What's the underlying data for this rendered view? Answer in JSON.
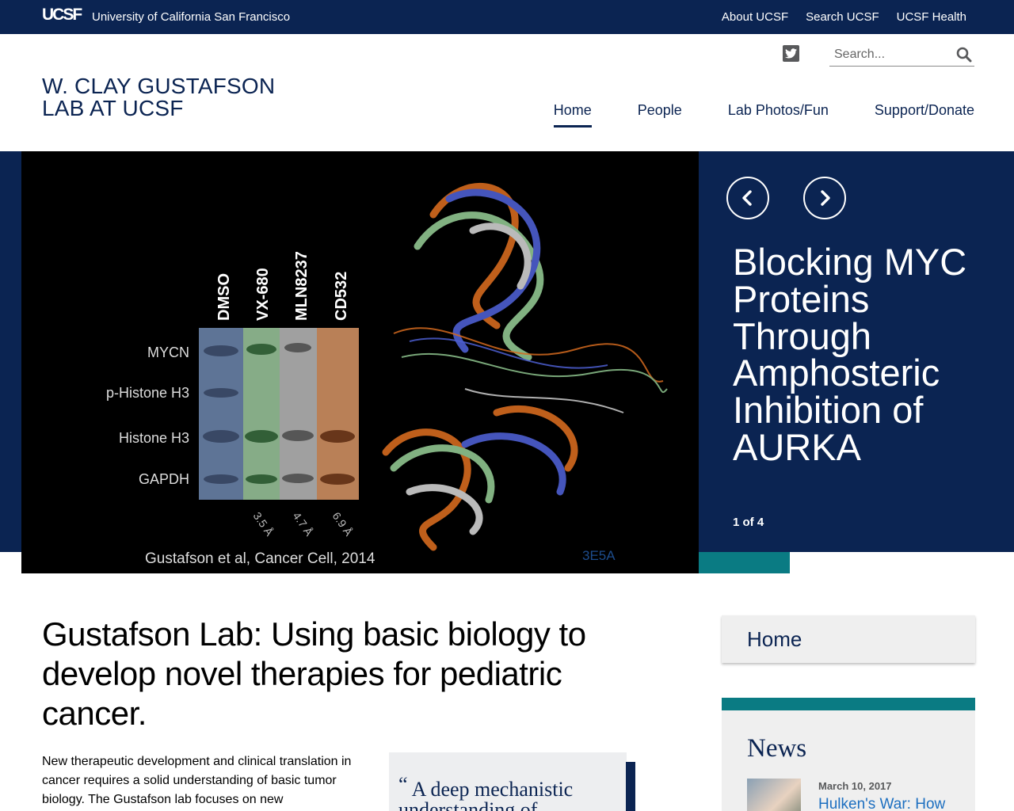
{
  "topbar": {
    "logo": "UCSF",
    "university": "University of California San Francisco",
    "links": [
      "About UCSF",
      "Search UCSF",
      "UCSF Health"
    ]
  },
  "header": {
    "site_title_line1": "W. CLAY GUSTAFSON",
    "site_title_line2": "LAB AT UCSF",
    "search_placeholder": "Search...",
    "nav": [
      {
        "label": "Home",
        "active": true
      },
      {
        "label": "People",
        "active": false
      },
      {
        "label": "Lab Photos/Fun",
        "active": false
      },
      {
        "label": "Support/Donate",
        "active": false
      }
    ]
  },
  "hero": {
    "image": {
      "lanes": [
        "DMSO",
        "VX-680",
        "MLN8237",
        "CD532"
      ],
      "rows": [
        "MYCN",
        "p-Histone H3",
        "Histone H3",
        "GAPDH"
      ],
      "resolutions": [
        "3.5 Å",
        "4.7 Å",
        "6.9 Å"
      ],
      "citation": "Gustafson et al, Cancer Cell, 2014",
      "pdb_id": "3E5A"
    },
    "slide_title": "Blocking MYC Proteins Through Amphosteric Inhibition of AURKA",
    "slide_counter": "1 of 4"
  },
  "main": {
    "headline": "Gustafson Lab: Using basic biology to develop novel therapies for pediatric cancer.",
    "intro": "New therapeutic development and clinical translation in cancer requires a solid understanding of basic tumor biology. The Gustafson lab focuses on new",
    "quote": "A deep mechanistic understanding of"
  },
  "sidebar": {
    "home_label": "Home",
    "news_title": "News",
    "news_date": "March 10, 2017",
    "news_item": "Hulken's War: How"
  },
  "colors": {
    "navy": "#0b2452",
    "teal": "#0a7b83"
  }
}
